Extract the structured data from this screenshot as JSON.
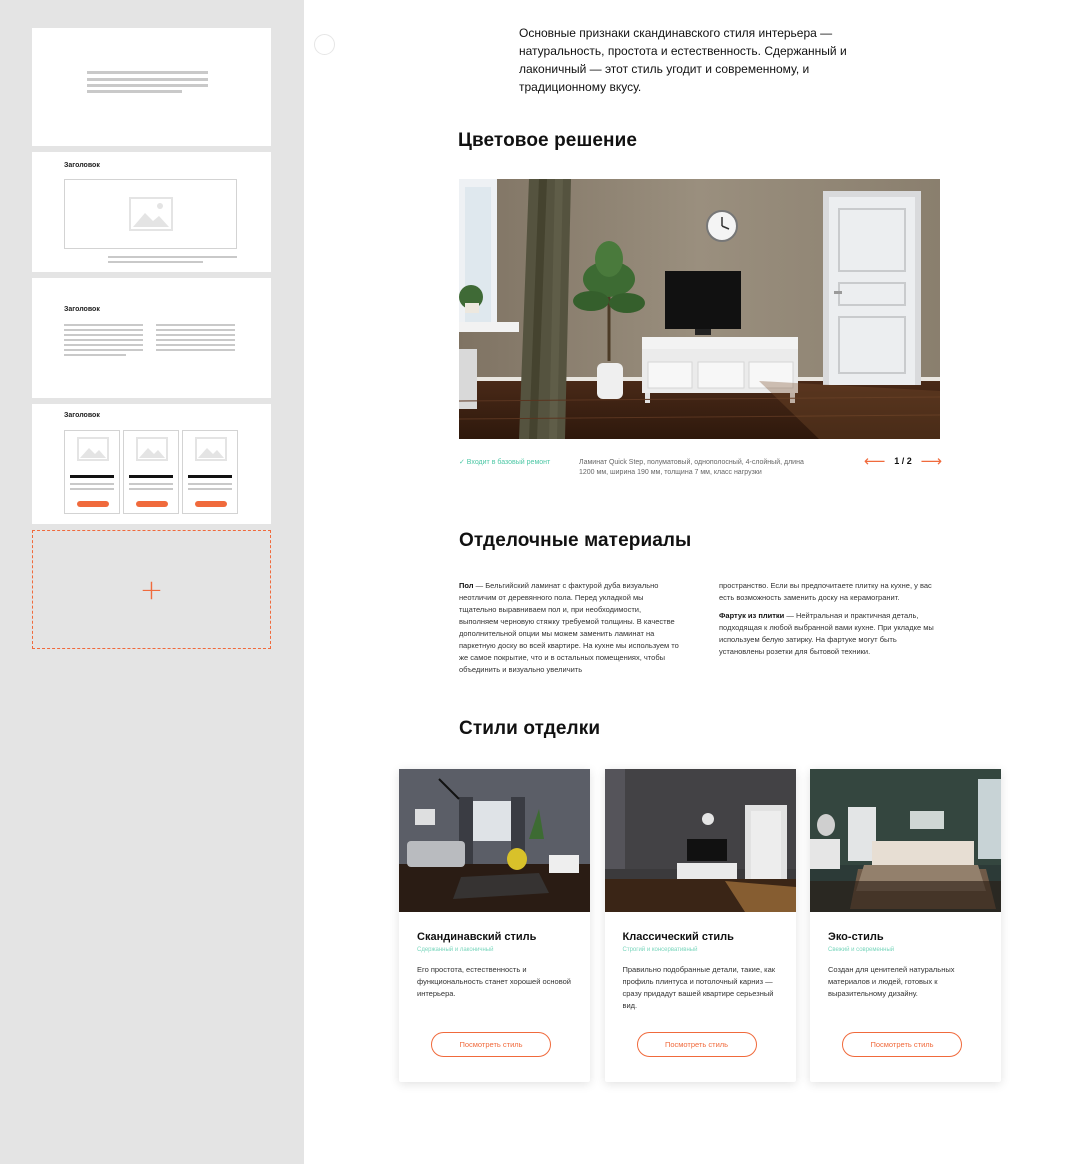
{
  "sidebar": {
    "thumb_titles": [
      "Заголовок",
      "Заголовок",
      "Заголовок"
    ],
    "add_block_icon": "plus-icon"
  },
  "intro": {
    "text": "Основные признаки скандинавского стиля интерьера — натуральность, простота и естественность. Сдержанный и лаконичный — этот стиль угодит и современному, и традиционному вкусу."
  },
  "color_section": {
    "title": "Цветовое решение",
    "check_label": "✓ Входит в базовый ремонт",
    "caption": "Ламинат Quick Step, полуматовый, однополосный, 4-слойный, длина 1200 мм, ширина 190 мм, толщина 7 мм, класс нагрузки",
    "counter": "1 / 2",
    "prev_icon": "arrow-left-icon",
    "next_icon": "arrow-right-icon"
  },
  "materials": {
    "title": "Отделочные материалы",
    "floor_label": "Пол",
    "floor_text": " — Бельгийский ламинат с фактурой дуба визуально неотличим от деревянного пола. Перед укладкой мы тщательно выравниваем пол и, при необходимости, выполняем черновую стяжку требуемой толщины. В качестве дополнительной опции мы можем заменить ламинат на паркетную доску во всей квартире. На кухне мы используем то же самое покрытие, что и в остальных помещениях, чтобы объединить и визуально увеличить",
    "col2_text": "пространство. Если вы предпочитаете плитку на кухне, у вас есть возможность заменить доску на керамогранит.",
    "apron_label": "Фартук из плитки",
    "apron_text": " — Нейтральная и практичная деталь, подходящая к любой выбранной вами кухне. При укладке мы используем белую затирку. На фартуке могут быть установлены розетки для бытовой техники."
  },
  "styles": {
    "title": "Стили отделки",
    "cards": [
      {
        "title": "Скандинавский стиль",
        "subtitle": "Сдержанный и лаконичный",
        "desc": "Его простота, естественность и функциональность станет хорошей основой интерьера.",
        "button": "Посмотреть стиль"
      },
      {
        "title": "Классический стиль",
        "subtitle": "Строгий и консервативный",
        "desc": "Правильно подобранные детали, такие, как профиль плинтуса и потолочный карниз — сразу придадут вашей квартире серьезный вид.",
        "button": "Посмотреть стиль"
      },
      {
        "title": "Эко-стиль",
        "subtitle": "Свежий и современный",
        "desc": "Создан для ценителей натуральных материалов и людей, готовых к выразительному дизайну.",
        "button": "Посмотреть стиль"
      }
    ]
  },
  "colors": {
    "accent": "#f06a3c",
    "mint": "#4cc7a5"
  }
}
